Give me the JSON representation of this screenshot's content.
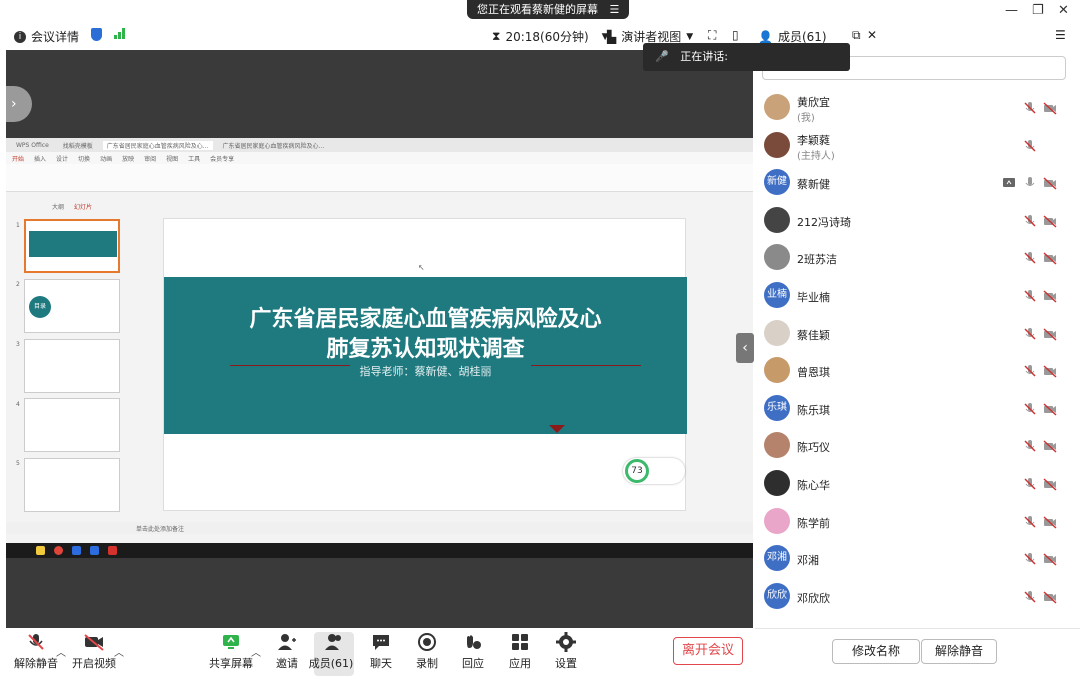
{
  "banner": {
    "text": "您正在观看蔡新健的屏幕",
    "menu_glyph": "☰"
  },
  "toolbar": {
    "meeting_info": "会议详情",
    "timer": "20:18(60分钟)",
    "view_mode": "演讲者视图",
    "members": "成员(61)"
  },
  "speaking": {
    "label": "正在讲话:"
  },
  "wps": {
    "tabs": [
      "WPS Office",
      "找稻壳模板",
      "广东省居民家庭心血管疾病风险及心...",
      "广东省居民家庭心血管疾病风险及心..."
    ],
    "menu": [
      "开始",
      "插入",
      "设计",
      "切换",
      "动画",
      "放映",
      "审阅",
      "视图",
      "工具",
      "会员专享"
    ],
    "left_tabs": [
      "大纲",
      "幻灯片"
    ],
    "thumb_numbers": [
      "1",
      "2",
      "3",
      "4",
      "5"
    ],
    "thumb2_label": "目录",
    "slide_title_line1": "广东省居民家庭心血管疾病风险及心",
    "slide_title_line2": "肺复苏认知现状调查",
    "slide_subtitle": "指导老师：蔡新健、胡桂丽",
    "perf_value": "73",
    "notes_placeholder": "单击此处添加备注"
  },
  "participants": [
    {
      "name": "黄欣宜",
      "sub": "(我)",
      "avatar_text": "",
      "avatar_color": "#c9a27a",
      "mic": "muted",
      "cam": "off"
    },
    {
      "name": "李颖蕤",
      "sub": "(主持人)",
      "avatar_text": "",
      "avatar_color": "#7a4b3a",
      "mic": "muted",
      "cam": ""
    },
    {
      "name": "蔡新健",
      "sub": "",
      "avatar_text": "新健",
      "avatar_color": "#3f6fc4",
      "mic": "on",
      "cam": "off",
      "sharing": true
    },
    {
      "name": "212冯诗琦",
      "sub": "",
      "avatar_text": "",
      "avatar_color": "#444444",
      "mic": "muted",
      "cam": "off"
    },
    {
      "name": "2班苏洁",
      "sub": "",
      "avatar_text": "",
      "avatar_color": "#8a8a8a",
      "mic": "muted",
      "cam": "off"
    },
    {
      "name": "毕业楠",
      "sub": "",
      "avatar_text": "业楠",
      "avatar_color": "#3f6fc4",
      "mic": "muted",
      "cam": "off"
    },
    {
      "name": "蔡佳颖",
      "sub": "",
      "avatar_text": "",
      "avatar_color": "#d9d0c7",
      "mic": "muted",
      "cam": "off"
    },
    {
      "name": "曾恩琪",
      "sub": "",
      "avatar_text": "",
      "avatar_color": "#c79a6a",
      "mic": "muted",
      "cam": "off"
    },
    {
      "name": "陈乐琪",
      "sub": "",
      "avatar_text": "乐琪",
      "avatar_color": "#3f6fc4",
      "mic": "muted",
      "cam": "off"
    },
    {
      "name": "陈巧仪",
      "sub": "",
      "avatar_text": "",
      "avatar_color": "#b5836b",
      "mic": "muted",
      "cam": "off"
    },
    {
      "name": "陈心华",
      "sub": "",
      "avatar_text": "",
      "avatar_color": "#2e2e2e",
      "mic": "muted",
      "cam": "off"
    },
    {
      "name": "陈学前",
      "sub": "",
      "avatar_text": "",
      "avatar_color": "#e9a6c8",
      "mic": "muted",
      "cam": "off"
    },
    {
      "name": "邓湘",
      "sub": "",
      "avatar_text": "邓湘",
      "avatar_color": "#3f6fc4",
      "mic": "muted",
      "cam": "off"
    },
    {
      "name": "邓欣欣",
      "sub": "",
      "avatar_text": "欣欣",
      "avatar_color": "#3f6fc4",
      "mic": "muted",
      "cam": "off"
    }
  ],
  "panel_buttons": {
    "rename": "修改名称",
    "unmute_all": "解除静音"
  },
  "controls": {
    "unmute": "解除静音",
    "start_video": "开启视频",
    "share_screen": "共享屏幕",
    "invite": "邀请",
    "members": "成员(61)",
    "chat": "聊天",
    "record": "录制",
    "reactions": "回应",
    "apps": "应用",
    "settings": "设置",
    "leave": "离开会议"
  },
  "colors": {
    "accent_blue": "#3f6fc4",
    "danger": "#e2474b",
    "slide_teal": "#1f7a80"
  }
}
